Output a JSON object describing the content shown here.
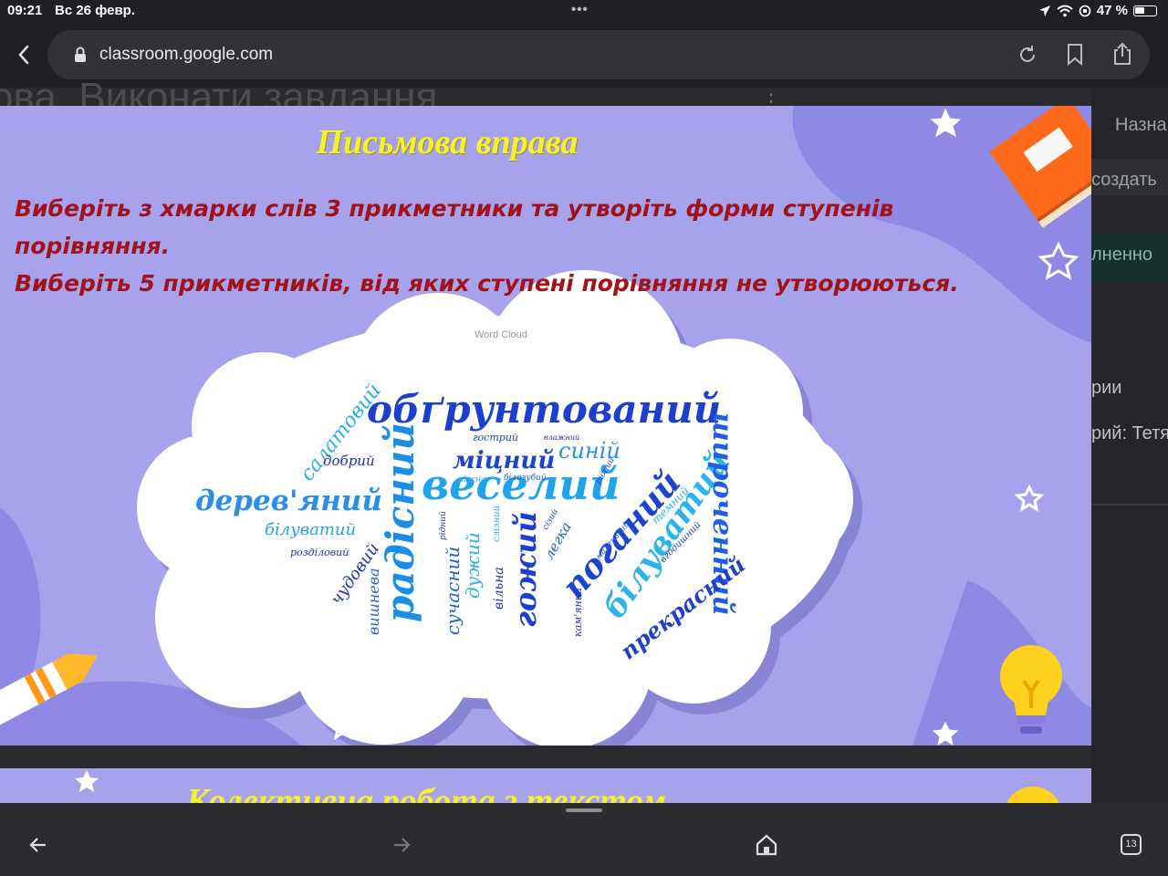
{
  "status_bar": {
    "time": "09:21",
    "date": "Вс 26 февр.",
    "battery": "47 %",
    "multitask_dots": "•••"
  },
  "browser": {
    "url": "classroom.google.com",
    "icons": [
      "back-icon",
      "lock-icon",
      "reload-icon",
      "bookmark-icon",
      "share-icon"
    ]
  },
  "background_page": {
    "heading_fragment": "ова. Виконати завдання",
    "side_items": [
      "Назна",
      "создать",
      "лненно",
      "рии",
      "рий: Тетя"
    ]
  },
  "slide": {
    "title": "Письмова вправа",
    "task_line1": "Виберіть з хмарки слів 3 прикметники та утворіть форми ступенів",
    "task_line2": "порівняння.",
    "task_line3": "Виберіть 5 прикметників, від яких ступені порівняння не утворюються.",
    "word_cloud_label": "Word Cloud",
    "word_cloud": [
      "обґрунтований",
      "веселий",
      "радісний",
      "дерев'яний",
      "поганий",
      "білуватий",
      "широченний",
      "гожий",
      "прекрасний",
      "міцний",
      "синій",
      "салатовий",
      "добрий",
      "білуватий",
      "розділовий",
      "чудовий",
      "вишнева",
      "сучасний",
      "дужий",
      "вільна",
      "легка",
      "гострий",
      "кам'яний",
      "темний",
      "вгодишний",
      "білозубий",
      "ніжна",
      "рідний",
      "слізний",
      "сізий",
      "маленький",
      "рідний",
      "влажний"
    ]
  },
  "next_slide": {
    "title_fragment": "Колективна робота з текстом"
  },
  "bottom_bar": {
    "tabs_count": "13",
    "icons": [
      "back-arrow-icon",
      "forward-arrow-icon",
      "home-icon",
      "tabs-icon"
    ]
  },
  "colors": {
    "slide_bg": "#a6a3ec",
    "title_yellow": "#f7f128",
    "task_red": "#a2121b",
    "chrome_dark": "#1f2023"
  }
}
